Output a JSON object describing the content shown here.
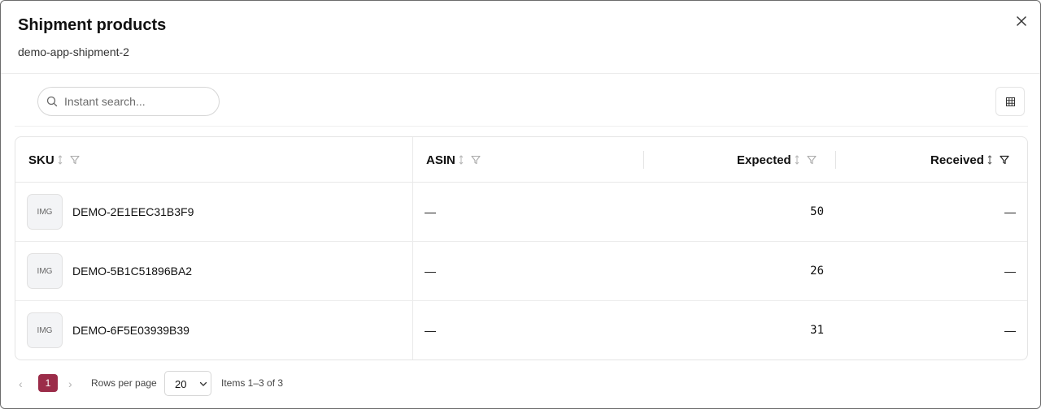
{
  "modal": {
    "title": "Shipment products",
    "subtitle": "demo-app-shipment-2"
  },
  "search": {
    "placeholder": "Instant search..."
  },
  "table": {
    "columns": [
      {
        "label": "SKU"
      },
      {
        "label": "ASIN"
      },
      {
        "label": "Expected"
      },
      {
        "label": "Received"
      }
    ],
    "rows": [
      {
        "thumb": "IMG",
        "sku": "DEMO-2E1EEC31B3F9",
        "asin": "—",
        "expected": "50",
        "received": "—"
      },
      {
        "thumb": "IMG",
        "sku": "DEMO-5B1C51896BA2",
        "asin": "—",
        "expected": "26",
        "received": "—"
      },
      {
        "thumb": "IMG",
        "sku": "DEMO-6F5E03939B39",
        "asin": "—",
        "expected": "31",
        "received": "—"
      }
    ]
  },
  "pagination": {
    "prev": "‹",
    "current": "1",
    "next": "›",
    "rows_per_page_label": "Rows per page",
    "rows_per_page_value": "20",
    "items_summary": "Items 1–3 of 3"
  },
  "colors": {
    "accent": "#9b2c49",
    "border": "#e4e4e4",
    "thumb_bg": "#f3f4f6"
  },
  "icons": {
    "close": "close-icon",
    "search": "search-icon",
    "columns": "grid-icon",
    "sort": "sort-icon",
    "filter": "filter-icon",
    "chevron": "chevron-down-icon"
  }
}
